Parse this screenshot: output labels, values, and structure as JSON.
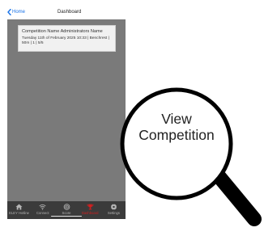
{
  "header": {
    "back_label": "Home",
    "title": "Dashboard"
  },
  "card": {
    "title": "Competition Name Administrators Name",
    "detail": "Tuesday 11th of February 2025 10:33 | Benchrest | 50m | 1 | 5/5"
  },
  "tabs": [
    {
      "label": "ELEY Hotline",
      "icon": "home-icon"
    },
    {
      "label": "Connect",
      "icon": "wifi-icon"
    },
    {
      "label": "Score",
      "icon": "target-icon"
    },
    {
      "label": "Dashboard",
      "icon": "trophy-icon",
      "active": true
    },
    {
      "label": "Settings",
      "icon": "gear-icon"
    }
  ],
  "callout": {
    "line1": "View",
    "line2": "Competition"
  },
  "colors": {
    "accent": "#1a73e8",
    "active_tab": "#d21f1f",
    "screen_bg": "#7a7a7a",
    "tabbar_bg": "#3b3b3b"
  }
}
